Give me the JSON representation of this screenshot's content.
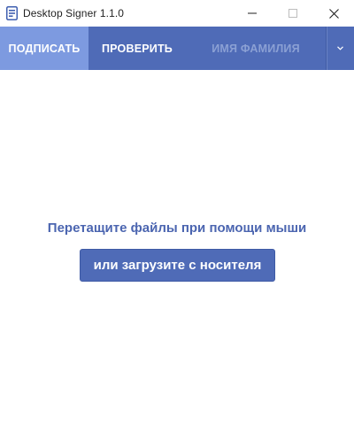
{
  "window": {
    "title": "Desktop Signer 1.1.0"
  },
  "tabs": {
    "sign": "ПОДПИСАТЬ",
    "verify": "ПРОВЕРИТЬ",
    "user": "ИМЯ ФАМИЛИЯ"
  },
  "main": {
    "drop_hint": "Перетащите файлы при помощи мыши",
    "upload_button": "или загрузите с носителя"
  },
  "icons": {
    "app": "document-sign-icon",
    "minimize": "minimize-icon",
    "maximize": "maximize-icon",
    "close": "close-icon",
    "dropdown": "chevron-down-icon"
  },
  "colors": {
    "accent": "#4f6bb7",
    "active_tab": "#7d9ae0",
    "inactive_text": "#8ba0d4",
    "hint_text": "#4b65b0"
  }
}
